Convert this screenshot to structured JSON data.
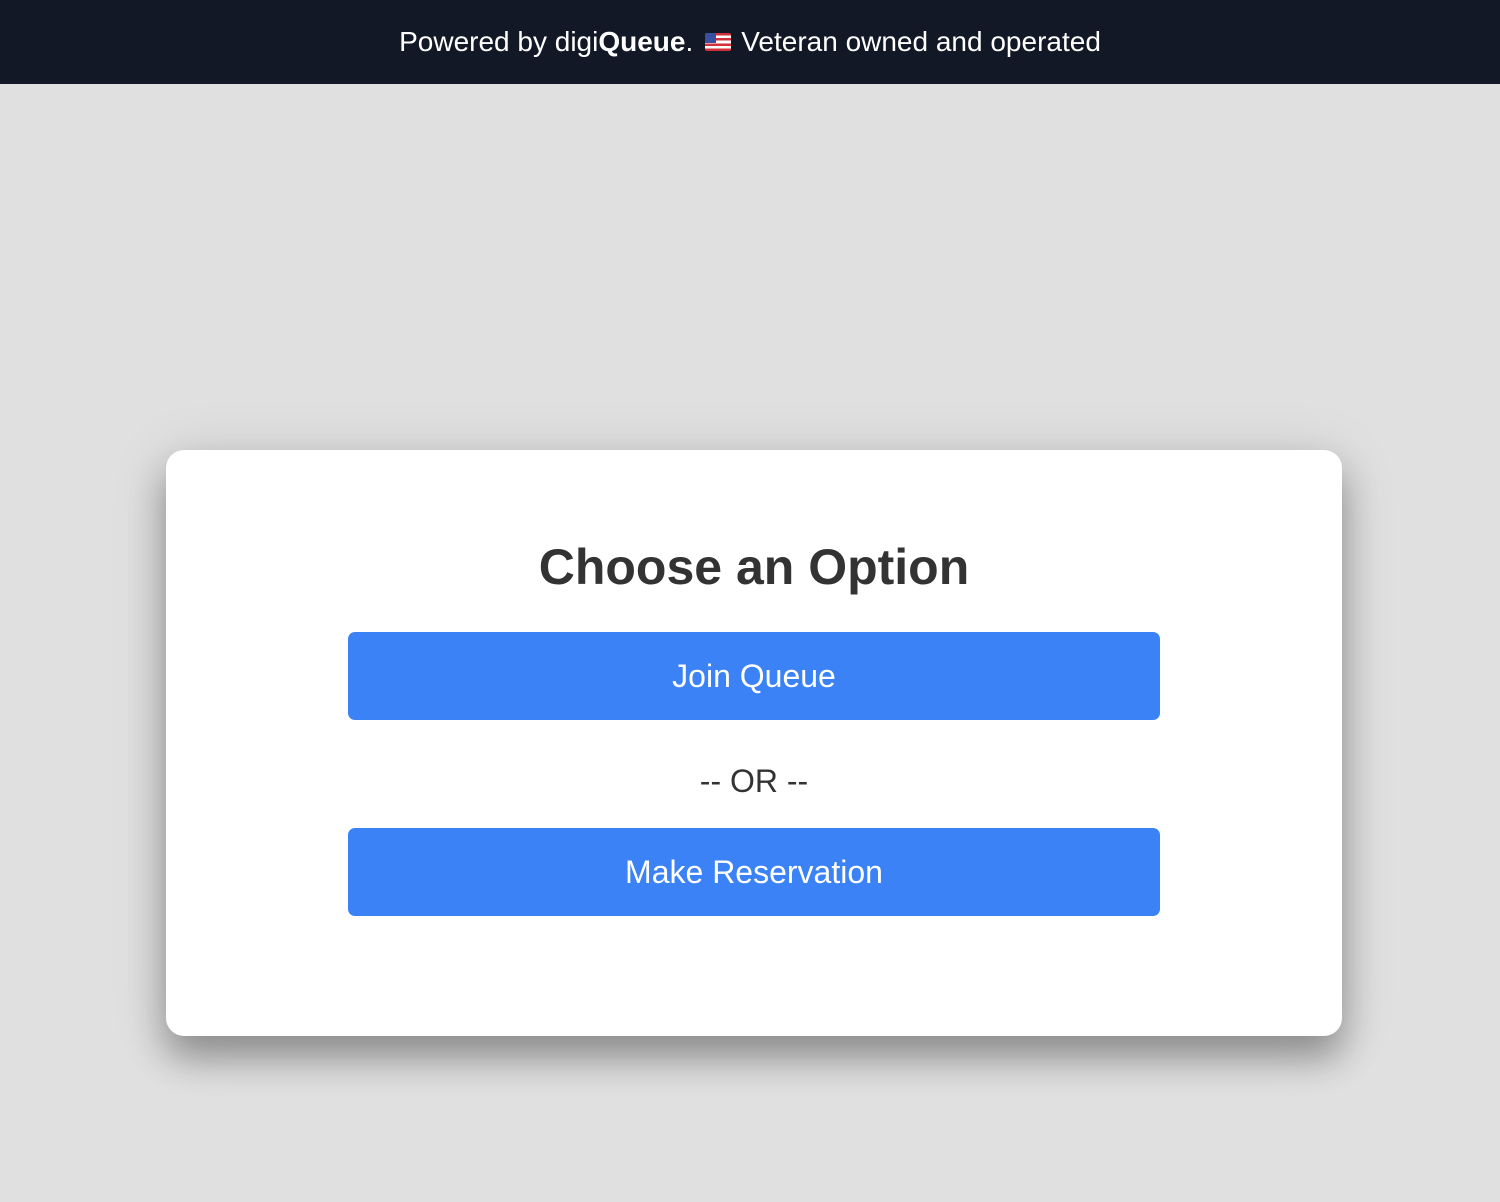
{
  "header": {
    "prefix": "Powered by digi",
    "brand_bold": "Queue",
    "suffix": ".",
    "flag_icon": "us-flag-icon",
    "tagline": "Veteran owned and operated",
    "background_color": "#131826"
  },
  "card": {
    "title": "Choose an Option",
    "join_button_label": "Join Queue",
    "separator": "-- OR --",
    "reservation_button_label": "Make Reservation",
    "button_color": "#3b82f6"
  }
}
